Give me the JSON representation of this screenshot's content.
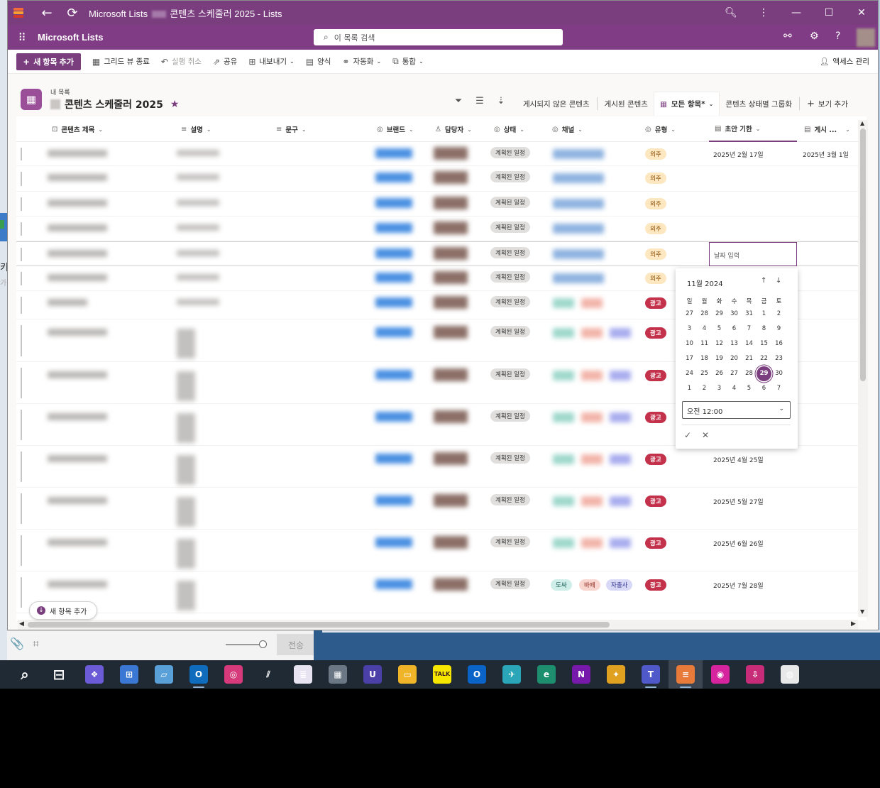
{
  "window": {
    "title": "Microsoft Lists ▒▒ 콘텐츠 스케줄러 2025 - Lists",
    "title_parts": {
      "app": "Microsoft Lists",
      "list": "콘텐츠 스케줄러 2025 - Lists"
    },
    "app_name": "Microsoft Lists",
    "search_placeholder": "이 목록 검색"
  },
  "commands": {
    "new_item": "새 항목 추가",
    "exit_grid": "그리드 뷰 종료",
    "undo": "실행 취소",
    "share": "공유",
    "export": "내보내기",
    "forms": "양식",
    "automate": "자동화",
    "integrate": "통합",
    "manage_access": "액세스 관리"
  },
  "list": {
    "breadcrumb": "내 목록",
    "title": "콘텐츠 스케줄러 2025",
    "views": [
      "게시되지 않은 콘텐츠",
      "게시된 콘텐츠",
      "모든 항목*",
      "콘텐츠 상태별 그룹화",
      "보기 추가"
    ]
  },
  "columns": {
    "title": "콘텐츠 제목",
    "desc": "설명",
    "copy": "문구",
    "brand": "브랜드",
    "owner": "담당자",
    "status": "상태",
    "channel": "채널",
    "type": "유형",
    "draft_due": "초안 기한",
    "publish": "게시 ..."
  },
  "values": {
    "status_planned": "계획된 일정",
    "type_outsource": "외주",
    "type_ad": "광고",
    "channel_labels": [
      "도싸",
      "바떼",
      "자출사"
    ]
  },
  "rows": [
    {
      "draft": "2025년 2월 17일",
      "publish": "2025년 3월 1일",
      "type": "외주"
    },
    {
      "draft": "",
      "publish": "",
      "type": "외주"
    },
    {
      "draft": "",
      "publish": "",
      "type": "외주"
    },
    {
      "draft": "",
      "publish": "",
      "type": "외주"
    },
    {
      "draft": "",
      "publish": "",
      "type": "외주"
    },
    {
      "draft": "",
      "publish": "",
      "type": "외주"
    },
    {
      "draft": "",
      "publish": "",
      "type": "광고"
    },
    {
      "draft": "",
      "publish": "",
      "type": "광고"
    },
    {
      "draft": "",
      "publish": "",
      "type": "광고"
    },
    {
      "draft": "",
      "publish": "",
      "type": "광고"
    },
    {
      "draft": "2025년 4월 25일",
      "publish": "",
      "type": "광고"
    },
    {
      "draft": "2025년 5월 27일",
      "publish": "",
      "type": "광고"
    },
    {
      "draft": "2025년 6월 26일",
      "publish": "",
      "type": "광고"
    },
    {
      "draft": "2025년 7월 28일",
      "publish": "",
      "type": "광고"
    }
  ],
  "date_editor": {
    "placeholder": "날짜 입력",
    "month_label": "11월 2024",
    "weekdays": [
      "일",
      "월",
      "화",
      "수",
      "목",
      "금",
      "토"
    ],
    "weeks": [
      [
        "27",
        "28",
        "29",
        "30",
        "31",
        "1",
        "2"
      ],
      [
        "3",
        "4",
        "5",
        "6",
        "7",
        "8",
        "9"
      ],
      [
        "10",
        "11",
        "12",
        "13",
        "14",
        "15",
        "16"
      ],
      [
        "17",
        "18",
        "19",
        "20",
        "21",
        "22",
        "23"
      ],
      [
        "24",
        "25",
        "26",
        "27",
        "28",
        "29",
        "30"
      ],
      [
        "1",
        "2",
        "3",
        "4",
        "5",
        "6",
        "7"
      ]
    ],
    "selected_day": "29",
    "time_value": "오전 12:00"
  },
  "footer": {
    "add_new": "새 항목 추가",
    "send": "전송"
  },
  "background_fragments": [
    "키",
    "가"
  ],
  "taskbar": {
    "apps": [
      "search-icon",
      "task-view-icon",
      "copilot-icon",
      "store-icon",
      "notepad-icon",
      "outlook-icon",
      "creative-cloud-icon",
      "app-icon",
      "notes-icon",
      "calculator-icon",
      "u-app-icon",
      "file-explorer-icon",
      "kakaotalk-icon",
      "outlook-new-icon",
      "bird-app-icon",
      "edge-icon",
      "onenote-icon",
      "medal-app-icon",
      "teams-icon",
      "lists-icon",
      "instagram-icon",
      "download-app-icon",
      "chrome-icon"
    ],
    "kakao_label": "TALK"
  },
  "colors": {
    "accent": "#7a3e7f",
    "ad_red": "#c4314b",
    "outsource_bg": "#fde7c0"
  }
}
